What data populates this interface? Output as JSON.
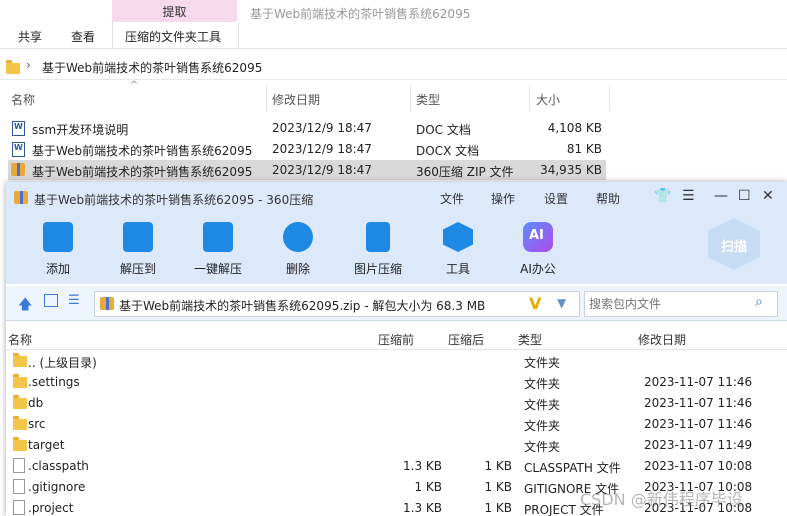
{
  "ribbon": {
    "context_tab": "提取",
    "tabs": [
      "共享",
      "查看",
      "压缩的文件夹工具"
    ],
    "window_title": "基于Web前端技术的茶叶销售系统62095"
  },
  "address": {
    "path": "基于Web前端技术的茶叶销售系统62095"
  },
  "explorer_columns": [
    "名称",
    "修改日期",
    "类型",
    "大小"
  ],
  "explorer_files": [
    {
      "name": "ssm开发环境说明",
      "date": "2023/12/9 18:47",
      "type": "DOC 文档",
      "size": "4,108 KB",
      "icon": "word-doc-icon"
    },
    {
      "name": "基于Web前端技术的茶叶销售系统62095",
      "date": "2023/12/9 18:47",
      "type": "DOCX 文档",
      "size": "81 KB",
      "icon": "word-doc-icon"
    },
    {
      "name": "基于Web前端技术的茶叶销售系统62095",
      "date": "2023/12/9 18:47",
      "type": "360压缩 ZIP 文件",
      "size": "34,935 KB",
      "icon": "zip-archive-icon"
    }
  ],
  "archiver": {
    "title": "基于Web前端技术的茶叶销售系统62095 - 360压缩",
    "menu": [
      "文件",
      "操作",
      "设置",
      "帮助"
    ],
    "tools": [
      {
        "label": "添加",
        "icon": "add-icon",
        "color": "#1e88e5"
      },
      {
        "label": "解压到",
        "icon": "extract-to-icon",
        "color": "#1e88e5"
      },
      {
        "label": "一键解压",
        "icon": "one-click-extract-icon",
        "color": "#1e88e5"
      },
      {
        "label": "删除",
        "icon": "delete-icon",
        "color": "#1e88e5"
      },
      {
        "label": "图片压缩",
        "icon": "image-compress-icon",
        "color": "#1e88e5"
      },
      {
        "label": "工具",
        "icon": "tools-icon",
        "color": "#1e88e5"
      },
      {
        "label": "AI办公",
        "icon": "ai-office-icon",
        "color": "#8e44ec"
      }
    ],
    "scan_label": "扫描",
    "path_text": "基于Web前端技术的茶叶销售系统62095.zip - 解包大小为 68.3 MB",
    "search_placeholder": "搜索包内文件",
    "columns": [
      "名称",
      "压缩前",
      "压缩后",
      "类型",
      "修改日期"
    ],
    "rows": [
      {
        "name": ".. (上级目录)",
        "before": "",
        "after": "",
        "type": "文件夹",
        "date": "",
        "kind": "folder"
      },
      {
        "name": ".settings",
        "before": "",
        "after": "",
        "type": "文件夹",
        "date": "2023-11-07 11:46",
        "kind": "folder"
      },
      {
        "name": "db",
        "before": "",
        "after": "",
        "type": "文件夹",
        "date": "2023-11-07 11:46",
        "kind": "folder"
      },
      {
        "name": "src",
        "before": "",
        "after": "",
        "type": "文件夹",
        "date": "2023-11-07 11:46",
        "kind": "folder"
      },
      {
        "name": "target",
        "before": "",
        "after": "",
        "type": "文件夹",
        "date": "2023-11-07 11:49",
        "kind": "folder"
      },
      {
        "name": ".classpath",
        "before": "1.3 KB",
        "after": "1 KB",
        "type": "CLASSPATH 文件",
        "date": "2023-11-07 10:08",
        "kind": "file"
      },
      {
        "name": ".gitignore",
        "before": "1 KB",
        "after": "1 KB",
        "type": "GITIGNORE 文件",
        "date": "2023-11-07 10:08",
        "kind": "file"
      },
      {
        "name": ".project",
        "before": "1.3 KB",
        "after": "1 KB",
        "type": "PROJECT 文件",
        "date": "2023-11-07 10:08",
        "kind": "file"
      }
    ]
  },
  "watermark": "CSDN @新伟程序毕设"
}
